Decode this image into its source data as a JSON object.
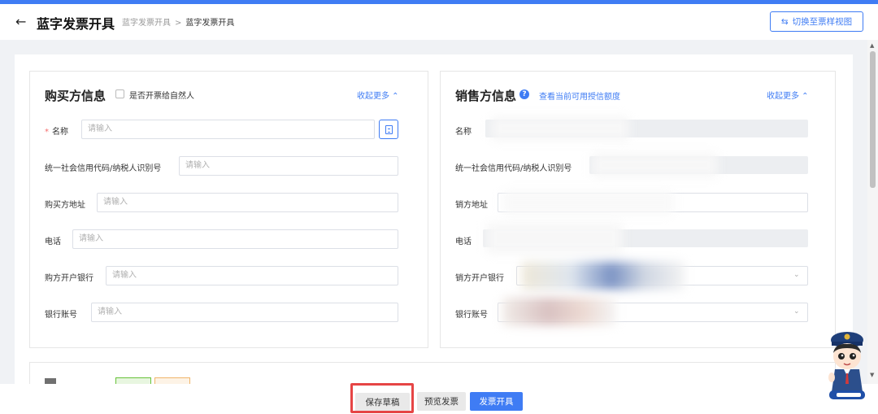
{
  "header": {
    "back_icon": "arrow-left-icon",
    "title": "蓝字发票开具",
    "breadcrumb": [
      "蓝字发票开具",
      ">",
      "蓝字发票开具"
    ],
    "switch_label": "切换至票样视图",
    "switch_icon": "swap-icon"
  },
  "buyer": {
    "title": "购买方信息",
    "natural_person_label": "是否开票给自然人",
    "collapse_label": "收起更多 ⌃",
    "fields": [
      {
        "label": "名称",
        "required": "*",
        "placeholder": "请输入"
      },
      {
        "label": "统一社会信用代码/纳税人识别号",
        "placeholder": "请输入"
      },
      {
        "label": "购买方地址",
        "placeholder": "请输入"
      },
      {
        "label": "电话",
        "placeholder": "请输入"
      },
      {
        "label": "购方开户银行",
        "placeholder": "请输入"
      },
      {
        "label": "银行账号",
        "placeholder": "请输入"
      }
    ]
  },
  "seller": {
    "title": "销售方信息",
    "info_icon": "?",
    "quota_link": "查看当前可用授信额度",
    "collapse_label": "收起更多 ⌃",
    "fields": [
      {
        "label": "名称"
      },
      {
        "label": "统一社会信用代码/纳税人识别号"
      },
      {
        "label": "销方地址"
      },
      {
        "label": "电话"
      },
      {
        "label": "销方开户银行"
      },
      {
        "label": "银行账号"
      }
    ]
  },
  "footer": {
    "save_label": "保存草稿",
    "preview_label": "预览发票",
    "issue_label": "发票开具"
  },
  "colors": {
    "accent": "#3f7cf4",
    "highlight": "#e64545"
  }
}
